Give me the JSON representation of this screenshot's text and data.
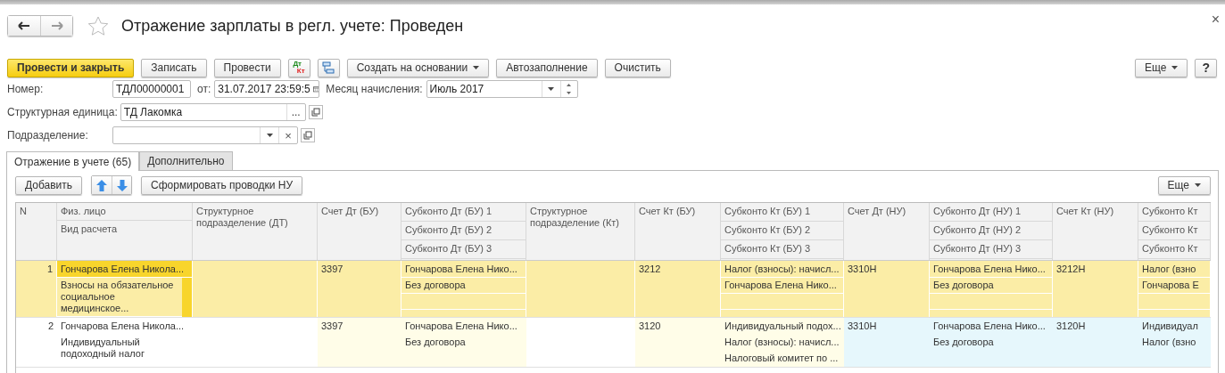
{
  "window": {
    "title": "Отражение зарплаты в регл. учете: Проведен",
    "close": "×",
    "favorite": false
  },
  "toolbar": {
    "buttons": [
      {
        "kind": "primary",
        "label": "Провести и закрыть"
      },
      {
        "kind": "normal",
        "label": "Записать"
      },
      {
        "kind": "normal",
        "label": "Провести"
      },
      {
        "kind": "dtkt",
        "label": "Дт",
        "sublabel": "Кт"
      },
      {
        "kind": "structure"
      },
      {
        "kind": "dropdown",
        "label": "Создать на основании"
      },
      {
        "kind": "normal",
        "label": "Автозаполнение"
      },
      {
        "kind": "normal",
        "label": "Очистить"
      }
    ],
    "more": "Еще",
    "help": "?"
  },
  "form": {
    "number_label": "Номер:",
    "number": "ТДЛ00000001",
    "date_label": "от:",
    "date": "31.07.2017 23:59:5",
    "month_label": "Месяц начисления:",
    "month": "Июль 2017",
    "unit_label": "Структурная единица:",
    "unit": "ТД Лакомка",
    "unit_select": "...",
    "dept_label": "Подразделение:",
    "dept_clear": "×"
  },
  "tabs": [
    {
      "label": "Отражение в учете (65)",
      "selected": true
    },
    {
      "label": "Дополнительно",
      "selected": false
    }
  ],
  "table_toolbar": {
    "add": "Добавить",
    "generate": "Сформировать проводки НУ",
    "more": "Еще"
  },
  "table": {
    "columns": [
      {
        "kind": "number",
        "headers": [
          "N"
        ]
      },
      {
        "kind": "plain",
        "headers": [
          "Физ. лицо",
          "Вид расчета"
        ]
      },
      {
        "kind": "plain",
        "headers": [
          "Структурное подразделение (ДТ)"
        ]
      },
      {
        "kind": "bu",
        "headers": [
          "Счет Дт (БУ)"
        ]
      },
      {
        "kind": "bu",
        "headers": [
          "Субконто Дт  (БУ) 1",
          "Субконто Дт  (БУ) 2",
          "Субконто Дт  (БУ) 3"
        ]
      },
      {
        "kind": "plain",
        "headers": [
          "Структурное подразделение (Кт)"
        ]
      },
      {
        "kind": "bu",
        "headers": [
          "Счет Кт  (БУ)"
        ]
      },
      {
        "kind": "bu",
        "headers": [
          "Субконто Кт  (БУ) 1",
          "Субконто Кт  (БУ) 2",
          "Субконто Кт  (БУ) 3"
        ]
      },
      {
        "kind": "nu",
        "headers": [
          "Счет Дт (НУ)"
        ]
      },
      {
        "kind": "nu",
        "headers": [
          "Субконто Дт (НУ) 1",
          "Субконто Дт (НУ) 2",
          "Субконто Дт (НУ) 3"
        ]
      },
      {
        "kind": "nu",
        "headers": [
          "Счет Кт (НУ)"
        ]
      },
      {
        "kind": "nu",
        "headers": [
          "Субконто Кт",
          "Субконто Кт",
          "Субконто Кт"
        ]
      }
    ],
    "rows": [
      {
        "selected": true,
        "cells": [
          {
            "lines": [
              "1"
            ],
            "focused": false
          },
          {
            "lines": [
              "Гончарова Елена Никола...",
              "Взносы на обязательное социальное медицинское..."
            ],
            "focused": true
          },
          {
            "focused": false
          },
          {
            "lines": [
              "3397"
            ],
            "focused": false
          },
          {
            "lines": [
              "Гончарова Елена Нико...",
              "Без договора"
            ],
            "focused": false
          },
          {
            "focused": false
          },
          {
            "lines": [
              "3212"
            ],
            "focused": false
          },
          {
            "lines": [
              "Налог (взносы): начисл...",
              "Гончарова Елена Нико..."
            ],
            "focused": false
          },
          {
            "lines": [
              "3310Н"
            ],
            "focused": false
          },
          {
            "lines": [
              "Гончарова Елена Нико...",
              "Без договора"
            ],
            "focused": false
          },
          {
            "lines": [
              "3212Н"
            ],
            "focused": false
          },
          {
            "lines": [
              "Налог (взно",
              "Гончарова Е"
            ],
            "focused": false
          }
        ]
      },
      {
        "selected": false,
        "cells": [
          {
            "lines": [
              "2"
            ],
            "focused": false
          },
          {
            "lines": [
              "Гончарова Елена Никола...",
              "Индивидуальный подоходный налог"
            ],
            "focused": false
          },
          {
            "focused": false
          },
          {
            "lines": [
              "3397"
            ],
            "focused": false
          },
          {
            "lines": [
              "Гончарова Елена Нико...",
              "Без договора"
            ],
            "focused": false
          },
          {
            "focused": false
          },
          {
            "lines": [
              "3120"
            ],
            "focused": false
          },
          {
            "lines": [
              "Индивидуальный подох...",
              "Налог (взносы): начисл...",
              "Налоговый комитет по ..."
            ],
            "focused": false
          },
          {
            "lines": [
              "3310Н"
            ],
            "focused": false
          },
          {
            "lines": [
              "Гончарова Елена Нико...",
              "Без договора"
            ],
            "focused": false
          },
          {
            "lines": [
              "3120Н"
            ],
            "focused": false
          },
          {
            "lines": [
              "Индивидуал",
              "Налог (взно"
            ],
            "focused": false
          }
        ]
      }
    ]
  }
}
